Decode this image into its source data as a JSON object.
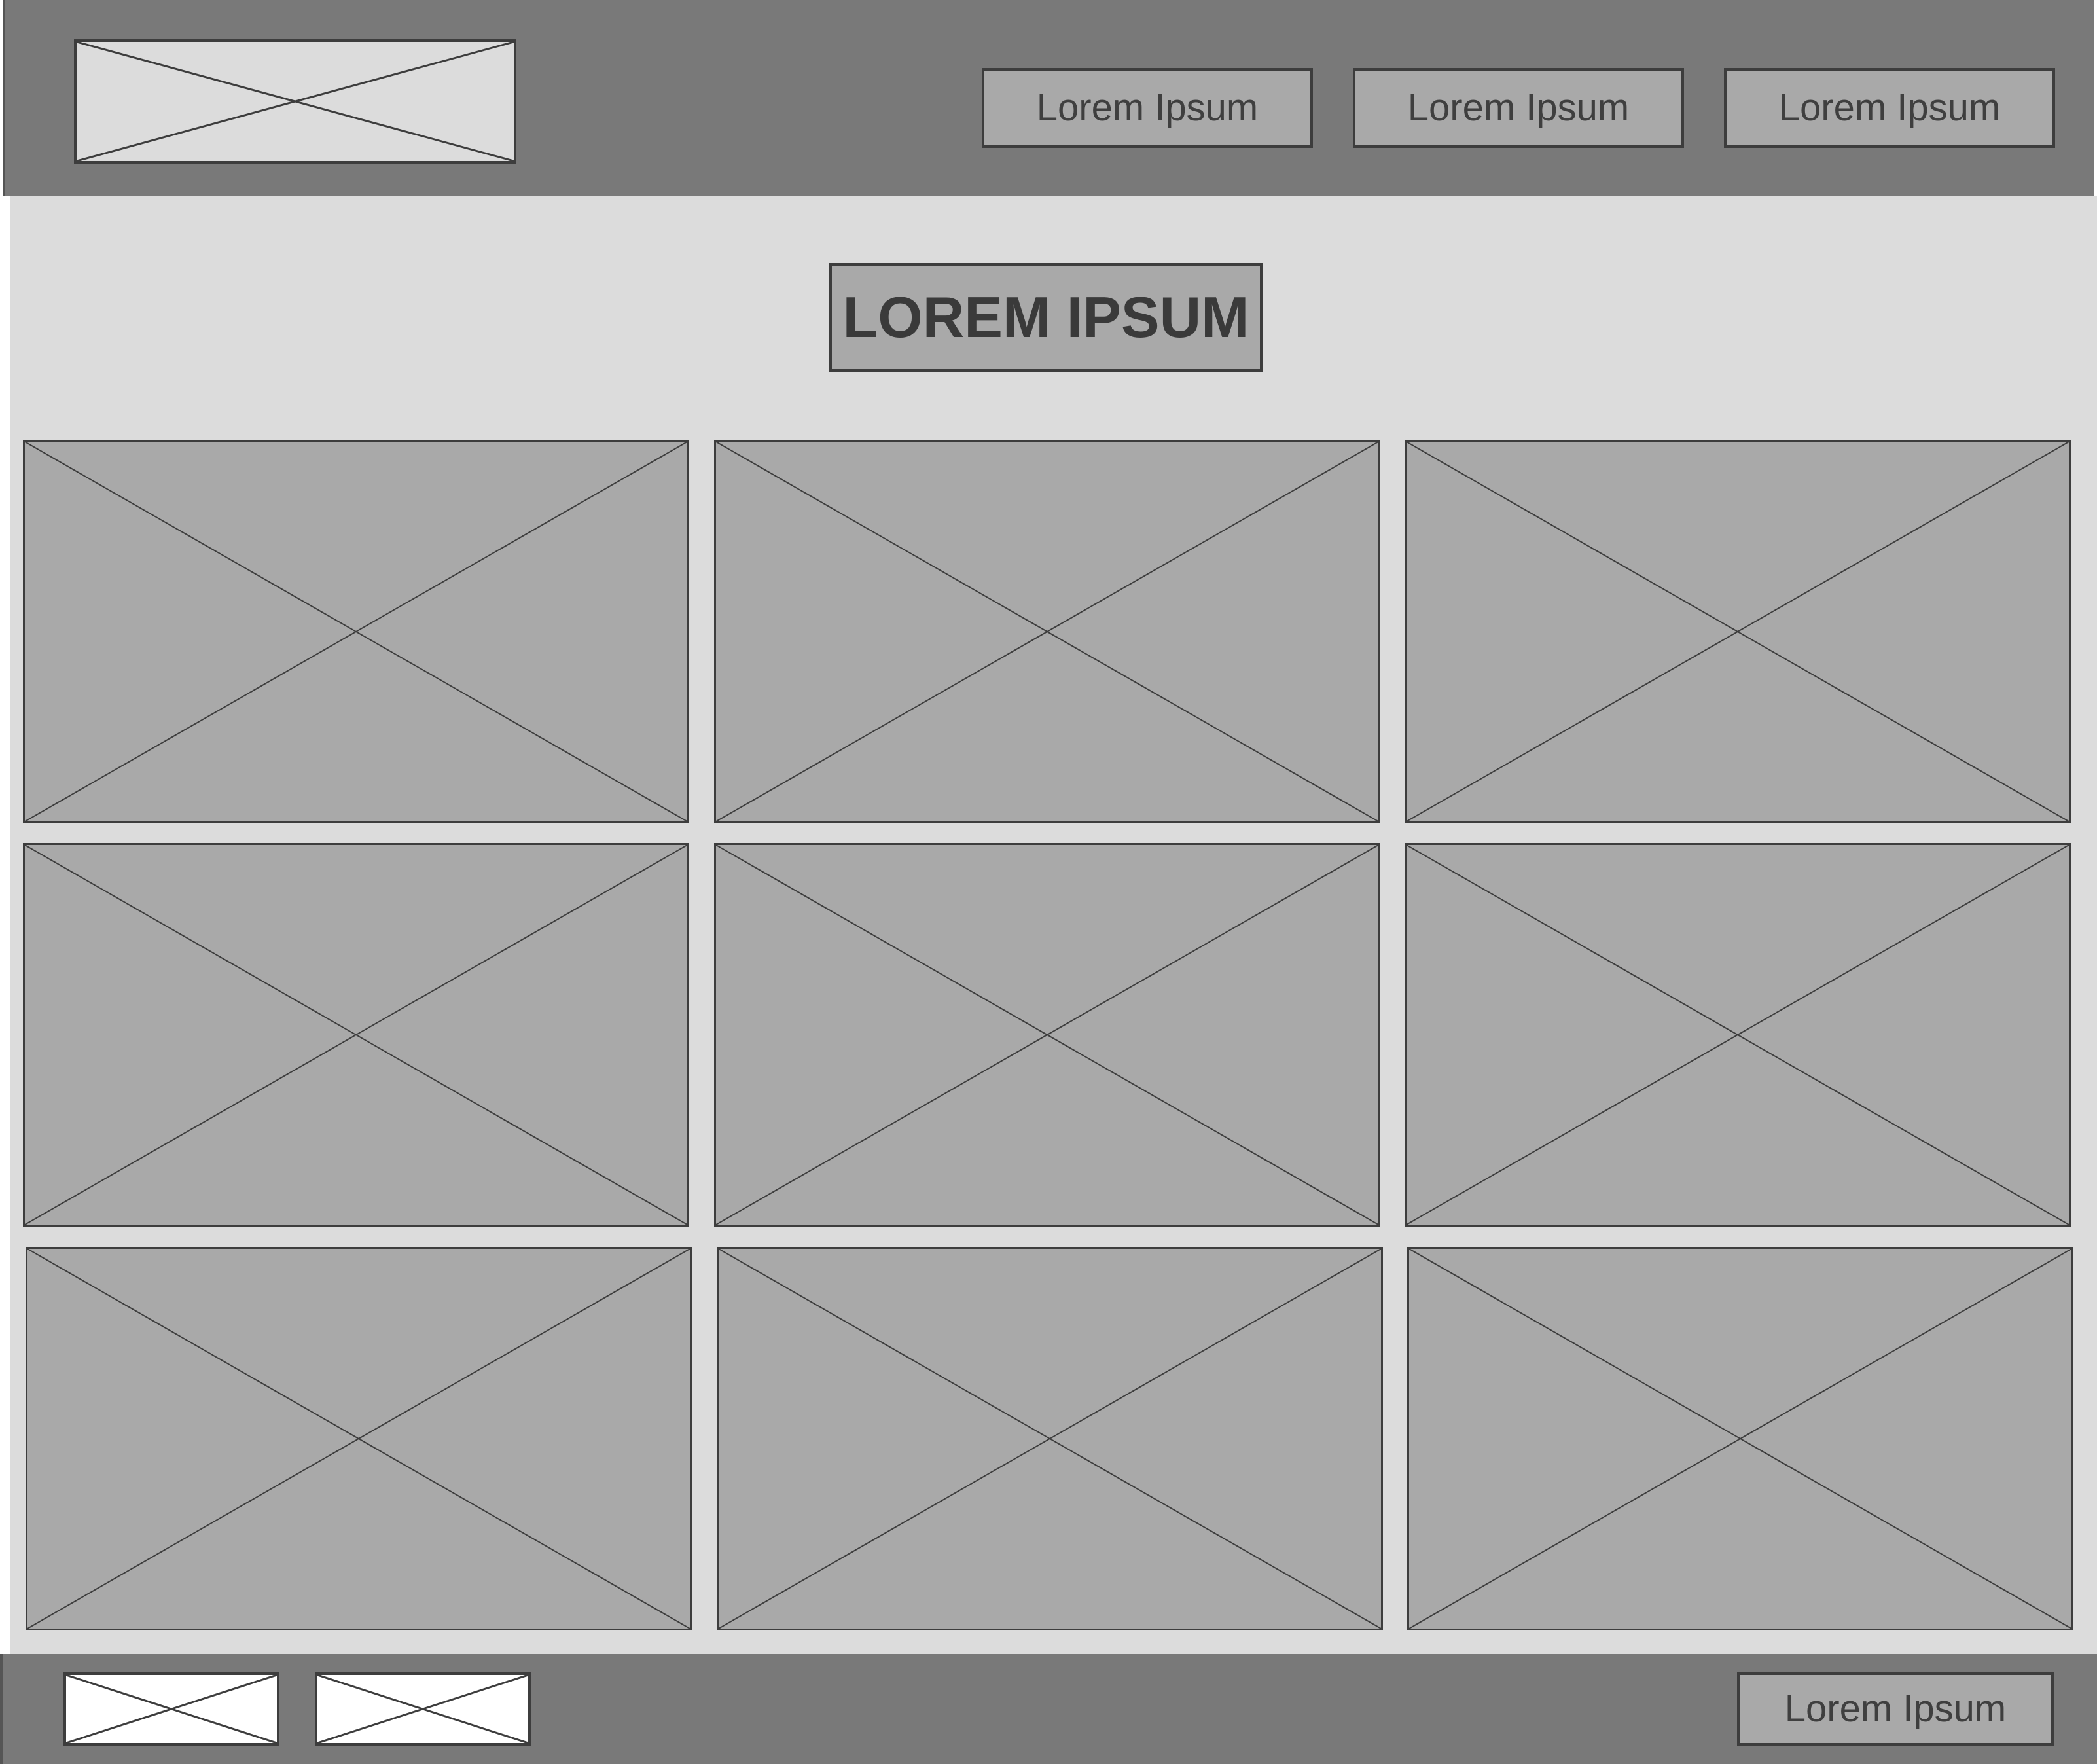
{
  "header": {
    "logo_icon": "image-placeholder-icon",
    "nav": [
      {
        "label": "Lorem Ipsum"
      },
      {
        "label": "Lorem Ipsum"
      },
      {
        "label": "Lorem Ipsum"
      }
    ]
  },
  "main": {
    "title": "LOREM IPSUM",
    "gallery_icon": "image-placeholder-icon",
    "gallery_count": 9
  },
  "footer": {
    "icons": [
      "image-placeholder-icon",
      "image-placeholder-icon"
    ],
    "button_label": "Lorem Ipsum"
  },
  "colors": {
    "bar": "#797979",
    "content_bg": "#dcdcdc",
    "box_fill": "#a9a9a9",
    "outline": "#3d3d3d",
    "text": "#3f3f3f"
  }
}
